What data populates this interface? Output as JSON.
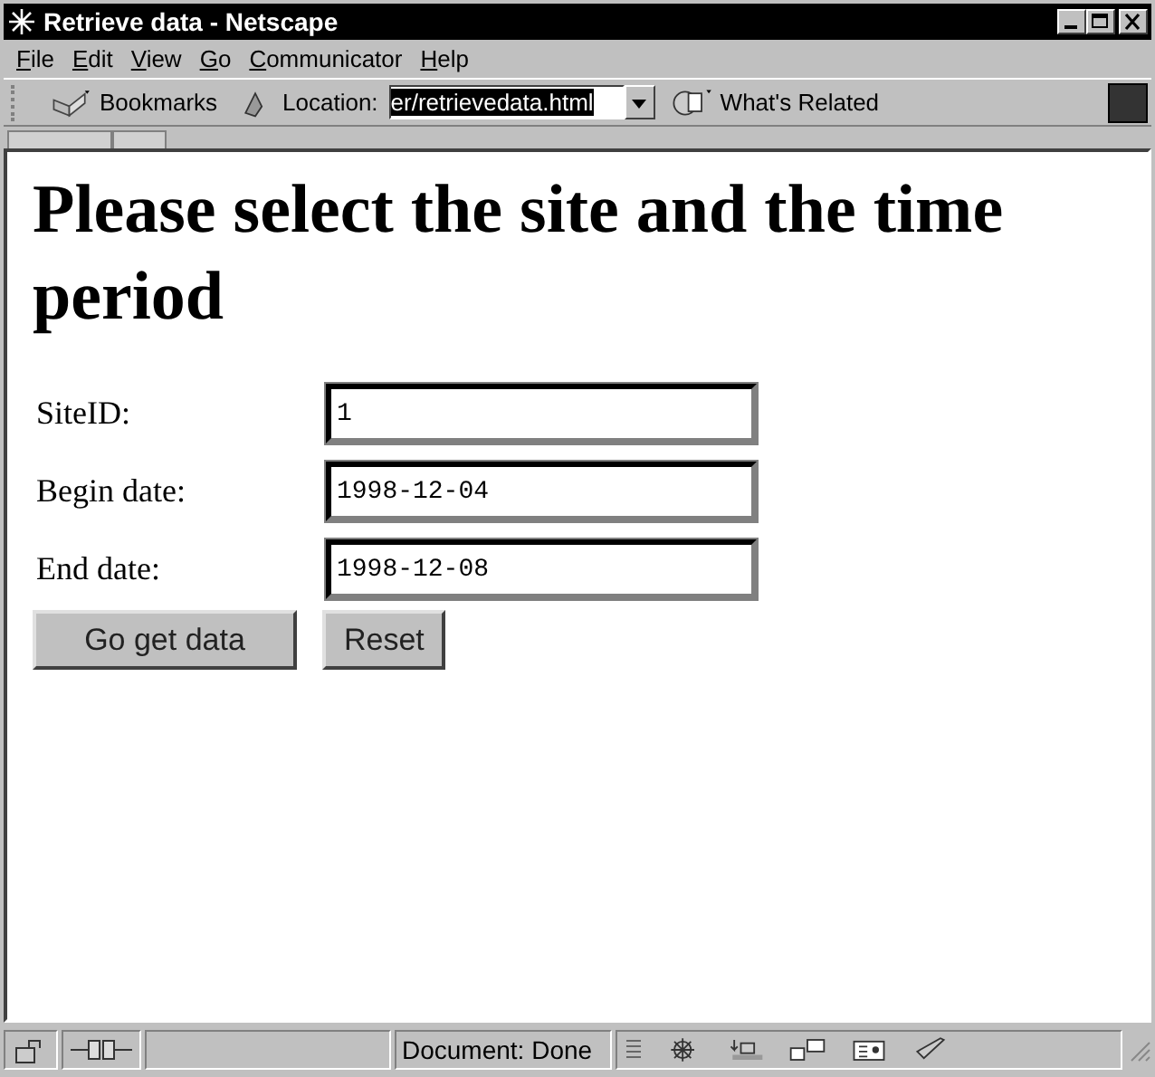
{
  "window": {
    "title": "Retrieve data - Netscape"
  },
  "menu": [
    {
      "label": "File"
    },
    {
      "label": "Edit"
    },
    {
      "label": "View"
    },
    {
      "label": "Go"
    },
    {
      "label": "Communicator"
    },
    {
      "label": "Help"
    }
  ],
  "toolbar": {
    "bookmarks": "Bookmarks",
    "location_label": "Location:",
    "location_value": "er/retrievedata.html",
    "whats_related": "What's Related"
  },
  "page": {
    "heading": "Please select the site and the time period",
    "fields": [
      {
        "label": "SiteID:",
        "value": "1"
      },
      {
        "label": "Begin date:",
        "value": "1998-12-04"
      },
      {
        "label": "End date:",
        "value": "1998-12-08"
      }
    ],
    "buttons": [
      "Go get data",
      "Reset"
    ]
  },
  "status_bar": {
    "text": "Document: Done"
  }
}
